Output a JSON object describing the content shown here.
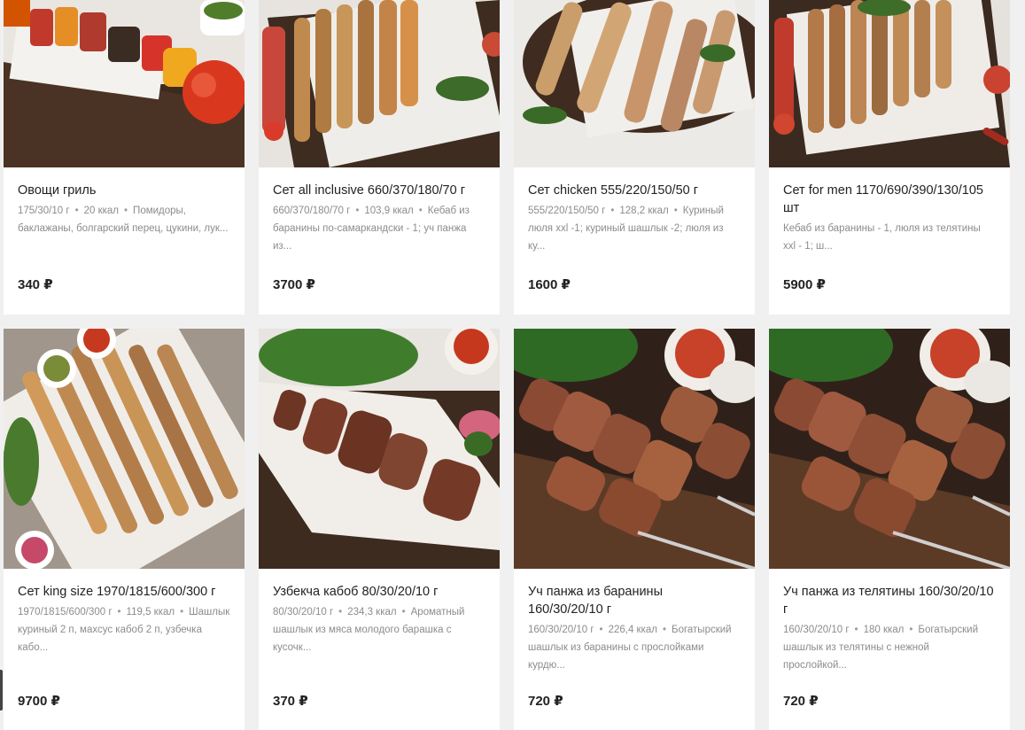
{
  "products": [
    {
      "title": "Овощи гриль",
      "weight": "175/30/10 г",
      "kcal": "20 ккал",
      "desc": "Помидоры, баклажаны, болгарский перец, цукини, лук...",
      "price": "340 ₽",
      "image": "grilled-vegetables-photo"
    },
    {
      "title": "Сет all inclusive 660/370/180/70 г",
      "weight": "660/370/180/70 г",
      "kcal": "103,9 ккал",
      "desc": "Кебаб из баранины по-самаркандски - 1; уч панжа из...",
      "price": "3700 ₽",
      "image": "skewer-set-photo"
    },
    {
      "title": "Сет chicken 555/220/150/50 г",
      "weight": "555/220/150/50 г",
      "kcal": "128,2 ккал",
      "desc": "Куриный люля xxl -1; куриный шашлык -2; люля из ку...",
      "price": "1600 ₽",
      "image": "chicken-set-photo"
    },
    {
      "title": "Сет for men 1170/690/390/130/105 шт",
      "weight": "",
      "kcal": "",
      "desc": "Кебаб из баранины - 1, люля из телятины xxl - 1; ш...",
      "price": "5900 ₽",
      "image": "men-set-photo"
    },
    {
      "title": "Сет king size 1970/1815/600/300 г",
      "weight": "1970/1815/600/300 г",
      "kcal": "119,5 ккал",
      "desc": "Шашлык куриный 2 п, махсус кабоб 2 п, узбечка кабо...",
      "price": "9700 ₽",
      "image": "king-size-set-photo"
    },
    {
      "title": "Узбекча кабоб 80/30/20/10 г",
      "weight": "80/30/20/10 г",
      "kcal": "234,3 ккал",
      "desc": "Ароматный шашлык из мяса молодого барашка с кусочк...",
      "price": "370 ₽",
      "image": "uzbek-kebab-photo"
    },
    {
      "title": "Уч панжа из баранины 160/30/20/10 г",
      "weight": "160/30/20/10 г",
      "kcal": "226,4 ккал",
      "desc": "Богатырский шашлык из баранины с прослойками курдю...",
      "price": "720 ₽",
      "image": "lamb-skewers-photo"
    },
    {
      "title": "Уч панжа из телятины 160/30/20/10 г",
      "weight": "160/30/20/10 г",
      "kcal": "180 ккал",
      "desc": "Богатырский шашлык из телятины с нежной прослойкой...",
      "price": "720 ₽",
      "image": "veal-skewers-photo"
    }
  ]
}
